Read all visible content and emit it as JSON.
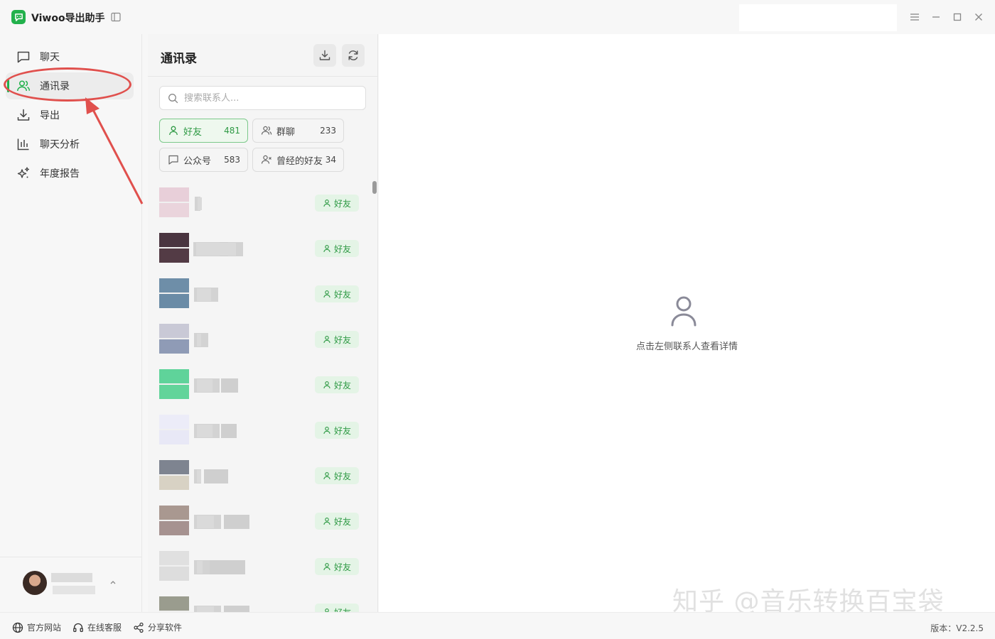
{
  "app": {
    "title": "Viwoo导出助手"
  },
  "nav": {
    "items": [
      {
        "label": "聊天",
        "icon": "chat-icon"
      },
      {
        "label": "通讯录",
        "icon": "contacts-icon",
        "active": true
      },
      {
        "label": "导出",
        "icon": "download-icon"
      },
      {
        "label": "聊天分析",
        "icon": "bar-chart-icon"
      },
      {
        "label": "年度报告",
        "icon": "sparkles-icon"
      }
    ]
  },
  "contacts": {
    "title": "通讯录",
    "search_placeholder": "搜索联系人...",
    "filters": [
      {
        "label": "好友",
        "count": "481",
        "active": true
      },
      {
        "label": "群聊",
        "count": "233"
      },
      {
        "label": "公众号",
        "count": "583"
      },
      {
        "label": "曾经的好友",
        "count": "34"
      }
    ],
    "rows": [
      {
        "tag": "好友",
        "colors": [
          "#e8cfd9",
          "#ead4dc"
        ]
      },
      {
        "tag": "好友",
        "colors": [
          "#4a3540",
          "#533b45"
        ]
      },
      {
        "tag": "好友",
        "colors": [
          "#6e8ea8",
          "#6a8ba6"
        ]
      },
      {
        "tag": "好友",
        "colors": [
          "#c9c9d6",
          "#8f9bb6"
        ]
      },
      {
        "tag": "好友",
        "colors": [
          "#5fd39a",
          "#62d49a"
        ]
      },
      {
        "tag": "好友",
        "colors": [
          "#ececf8",
          "#e8e8f6"
        ]
      },
      {
        "tag": "好友",
        "colors": [
          "#7e8490",
          "#d8d2c4"
        ]
      },
      {
        "tag": "好友",
        "colors": [
          "#a99890",
          "#a69290"
        ]
      },
      {
        "tag": "好友",
        "colors": [
          "#e0e0e0",
          "#dddddd"
        ]
      },
      {
        "tag": "好友",
        "colors": [
          "#9a9c8e",
          "#a0a294"
        ]
      }
    ]
  },
  "detail": {
    "empty_text": "点击左侧联系人查看详情"
  },
  "watermark": "知乎 @音乐转换百宝袋",
  "footer": {
    "links": [
      {
        "label": "官方网站",
        "icon": "globe-icon"
      },
      {
        "label": "在线客服",
        "icon": "headset-icon"
      },
      {
        "label": "分享软件",
        "icon": "share-icon"
      }
    ],
    "version": "版本：V2.2.5"
  },
  "colors": {
    "accent": "#22b14c",
    "annotation": "#e0504d"
  }
}
